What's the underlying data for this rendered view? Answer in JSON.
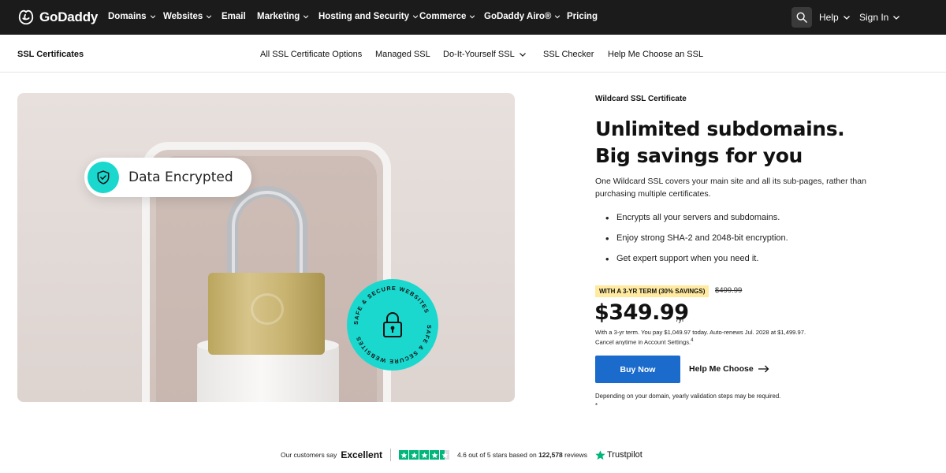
{
  "topnav": {
    "brand": "GoDaddy",
    "items": [
      {
        "label": "Domains",
        "has_menu": true
      },
      {
        "label": "Websites",
        "has_menu": true
      },
      {
        "label": "Email",
        "has_menu": false
      },
      {
        "label": "Marketing",
        "has_menu": true
      },
      {
        "label": "Hosting and Security",
        "has_menu": true
      },
      {
        "label": "Commerce",
        "has_menu": true
      },
      {
        "label": "GoDaddy Airo®",
        "has_menu": true
      },
      {
        "label": "Pricing",
        "has_menu": false
      }
    ],
    "help_label": "Help",
    "signin_label": "Sign In",
    "search_icon": "search-icon"
  },
  "subnav": {
    "title": "SSL Certificates",
    "items": [
      {
        "label": "All SSL Certificate Options"
      },
      {
        "label": "Managed SSL"
      },
      {
        "label": "Do-It-Yourself SSL"
      },
      {
        "label": "SSL Checker"
      },
      {
        "label": "Help Me Choose an SSL"
      }
    ]
  },
  "hero": {
    "pill_text": "Data Encrypted",
    "badge_text": "SAFE & SECURE WEBSITES"
  },
  "product": {
    "eyebrow": "Wildcard SSL Certificate",
    "headline_line1": "Unlimited subdomains.",
    "headline_line2": "Big savings for you",
    "intro": "One Wildcard SSL covers your main site and all its sub-pages, rather than purchasing multiple certificates.",
    "bullets": [
      "Encrypts all your servers and subdomains.",
      "Enjoy strong SHA-2 and 2048-bit encryption.",
      "Get expert support when you need it."
    ],
    "savings_tag": "WITH A 3-YR TERM (30% SAVINGS)",
    "old_price": "$499.99",
    "price": "$349.99",
    "per": "/yr",
    "terms_line1": "With a 3-yr term. You pay $1,049.97 today. Auto-renews Jul. 2028 at $1,499.97.",
    "terms_line2": "Cancel anytime in Account Settings.",
    "terms_sup": "4",
    "buy_label": "Buy Now",
    "help_label": "Help Me Choose",
    "footnote": "Depending on your domain, yearly validation steps may be required. *"
  },
  "trust": {
    "say": "Our customers say",
    "rating_word": "Excellent",
    "stars": 4.5,
    "score_prefix": "4.6 out of 5 stars based on",
    "review_count": "122,578",
    "score_suffix": "reviews",
    "brand": "Trustpilot"
  },
  "colors": {
    "nav_bg": "#1b1b1b",
    "accent_teal": "#1bd8cf",
    "button_blue": "#1a6bcc",
    "savings_yellow": "#ffeaa0",
    "trustpilot_green": "#00b67a"
  }
}
